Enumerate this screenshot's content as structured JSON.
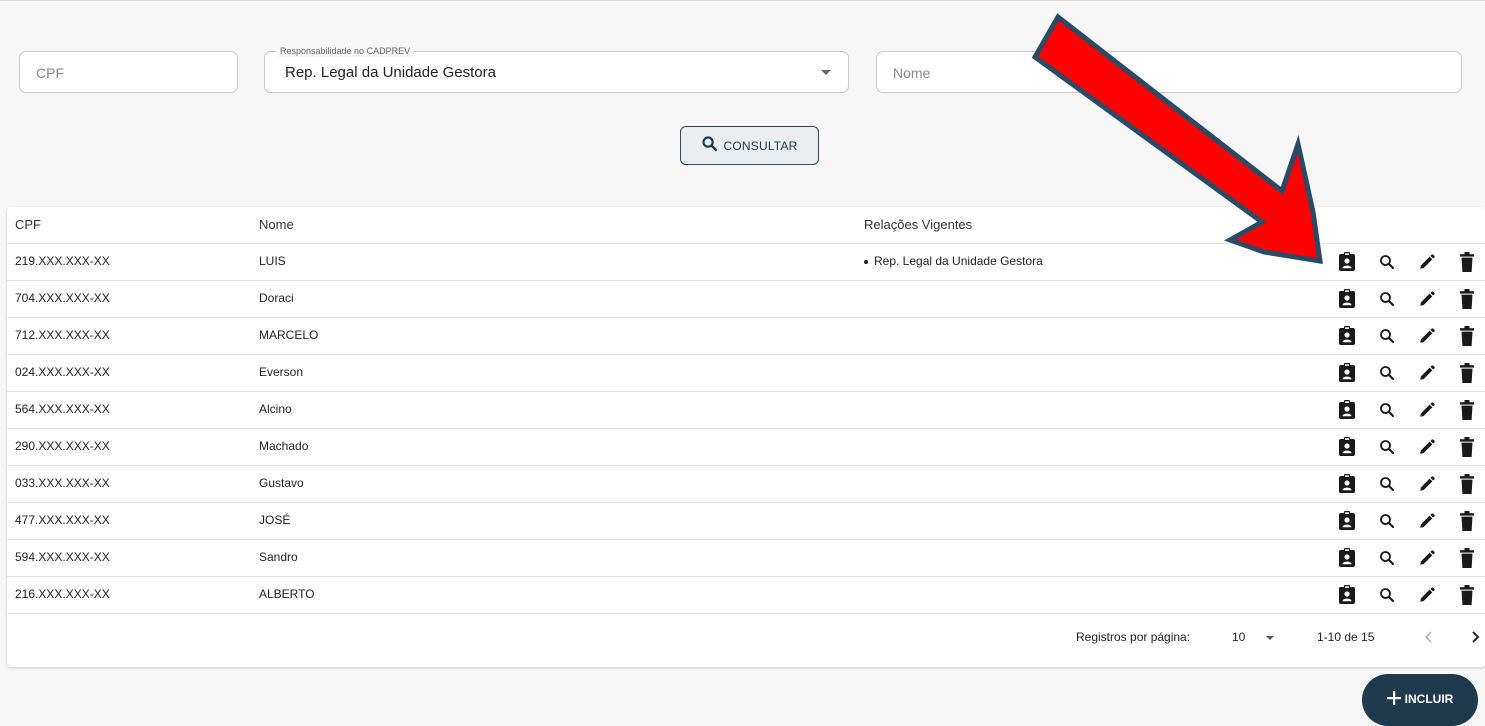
{
  "filters": {
    "cpf_placeholder": "CPF",
    "responsabilidade_label": "Responsabilidade no CADPREV",
    "responsabilidade_value": "Rep. Legal da Unidade Gestora",
    "nome_placeholder": "Nome",
    "consultar_label": "CONSULTAR"
  },
  "table": {
    "headers": {
      "cpf": "CPF",
      "nome": "Nome",
      "relacoes": "Relações Vigentes"
    },
    "rows": [
      {
        "cpf": "219.XXX.XXX-XX",
        "nome": "LUIS",
        "relacao": "Rep. Legal da Unidade Gestora"
      },
      {
        "cpf": "704.XXX.XXX-XX",
        "nome": "Doraci",
        "relacao": ""
      },
      {
        "cpf": "712.XXX.XXX-XX",
        "nome": "MARCELO",
        "relacao": ""
      },
      {
        "cpf": "024.XXX.XXX-XX",
        "nome": "Everson",
        "relacao": ""
      },
      {
        "cpf": "564.XXX.XXX-XX",
        "nome": "Alcino",
        "relacao": ""
      },
      {
        "cpf": "290.XXX.XXX-XX",
        "nome": "Machado",
        "relacao": ""
      },
      {
        "cpf": "033.XXX.XXX-XX",
        "nome": "Gustavo",
        "relacao": ""
      },
      {
        "cpf": "477.XXX.XXX-XX",
        "nome": "JOSÉ",
        "relacao": ""
      },
      {
        "cpf": "594.XXX.XXX-XX",
        "nome": "Sandro",
        "relacao": ""
      },
      {
        "cpf": "216.XXX.XXX-XX",
        "nome": "ALBERTO",
        "relacao": ""
      }
    ],
    "row_actions": [
      "badge-icon",
      "search-icon",
      "edit-icon",
      "delete-icon"
    ]
  },
  "pagination": {
    "rows_per_page_label": "Registros por página:",
    "rows_per_page": "10",
    "range": "1-10 de 15"
  },
  "incluir_label": "INCLUIR",
  "colors": {
    "primary": "#1f3a4d",
    "annotation_arrow_fill": "#ff0000",
    "annotation_arrow_outline": "#2b4a66"
  }
}
